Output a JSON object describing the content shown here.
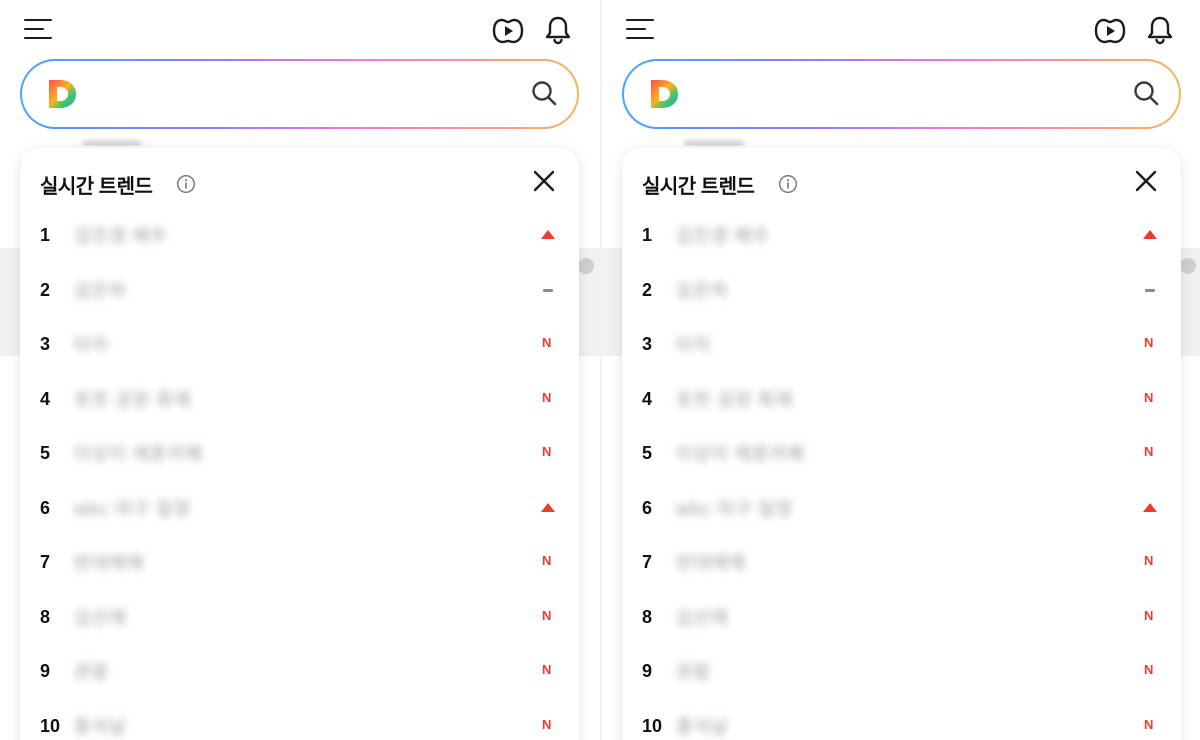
{
  "colors": {
    "accent_red": "#ef3b2d",
    "neutral_gray": "#8c8c8c",
    "search_gradient": [
      "#4aa3ff",
      "#8a7cff",
      "#f07ad0",
      "#f6b45a"
    ]
  },
  "icons": {
    "menu": "menu-icon",
    "video": "play-icon",
    "notifications": "bell-icon",
    "logo": "daum-logo-icon",
    "search": "search-icon",
    "info": "info-icon",
    "close": "close-icon"
  },
  "search": {
    "value": "",
    "placeholder": ""
  },
  "trend_panel": {
    "title": "실시간 트렌드",
    "items": [
      {
        "rank": "1",
        "keyword": "김진경 배우",
        "status": "up"
      },
      {
        "rank": "2",
        "keyword": "김은하",
        "status": "same"
      },
      {
        "rank": "3",
        "keyword": "타자",
        "status": "new"
      },
      {
        "rank": "4",
        "keyword": "포천 공장 화재",
        "status": "new"
      },
      {
        "rank": "5",
        "keyword": "이상이 재혼카페",
        "status": "new"
      },
      {
        "rank": "6",
        "keyword": "wbc 야구 일정",
        "status": "up"
      },
      {
        "rank": "7",
        "keyword": "반대매매",
        "status": "new"
      },
      {
        "rank": "8",
        "keyword": "김선재",
        "status": "new"
      },
      {
        "rank": "9",
        "keyword": "관람",
        "status": "new"
      },
      {
        "rank": "10",
        "keyword": "풍석날",
        "status": "new"
      }
    ],
    "status_labels": {
      "new": "N"
    }
  }
}
